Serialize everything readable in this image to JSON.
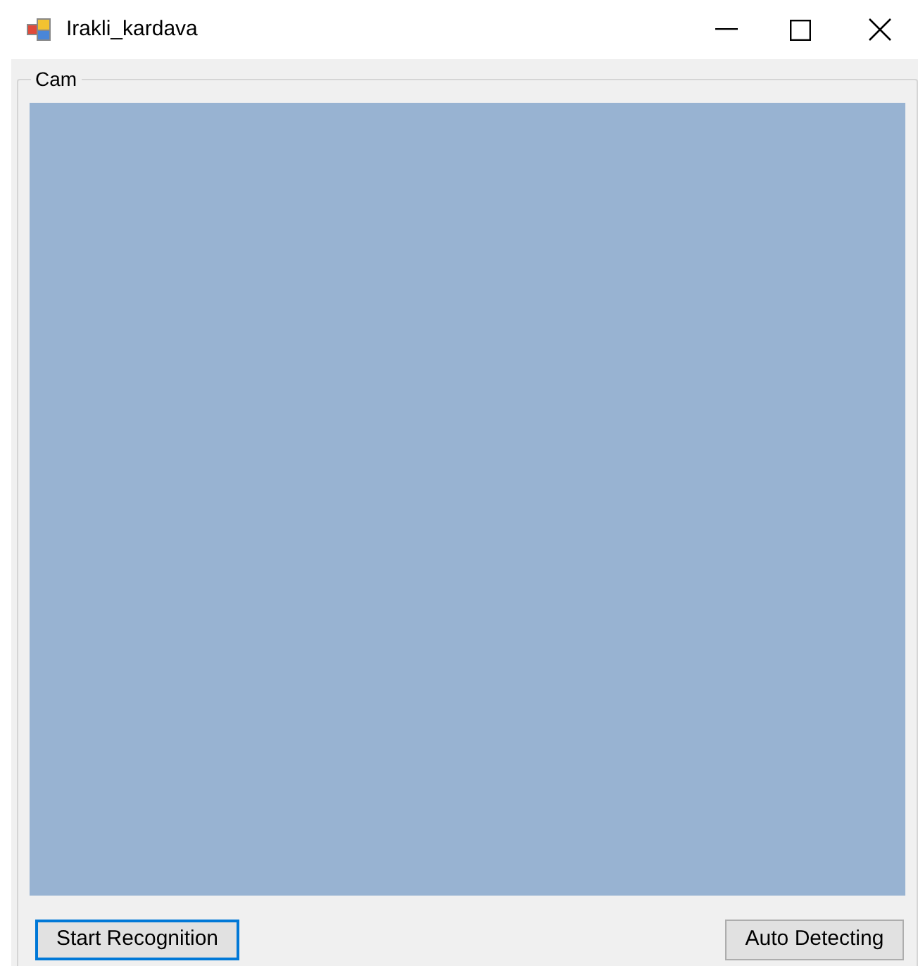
{
  "window": {
    "title": "Irakli_kardava"
  },
  "group": {
    "label": "Cam"
  },
  "buttons": [
    {
      "label": "Start Recognition",
      "focused": true
    },
    {
      "label": "Auto Detecting",
      "focused": false
    }
  ]
}
